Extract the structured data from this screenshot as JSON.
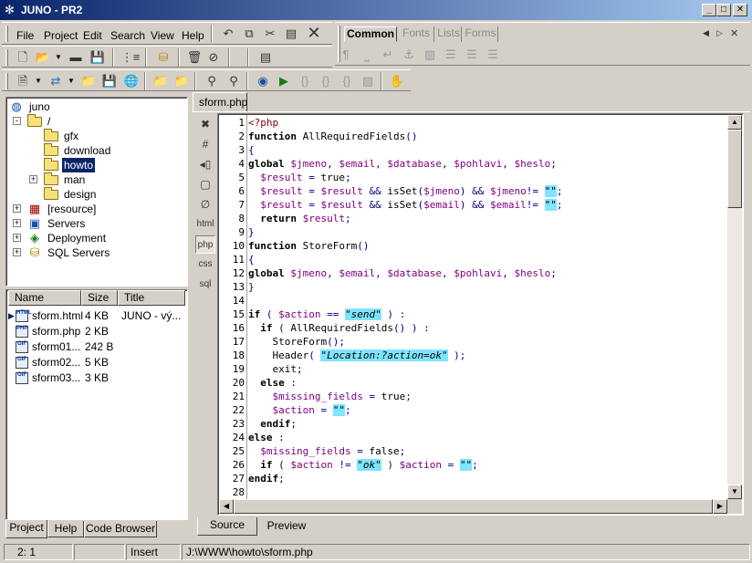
{
  "window": {
    "title": "JUNO - PR2",
    "minimize_label": "_",
    "maximize_label": "□",
    "close_label": "✕"
  },
  "menu": [
    "File",
    "Project",
    "Edit",
    "Search",
    "View",
    "Help"
  ],
  "formatting_tabs": [
    "Common",
    "Fonts",
    "Lists",
    "Forms"
  ],
  "icons": {
    "toolbar1": [
      "new-file-icon",
      "open-folder-icon",
      "save-icon",
      "save-all-icon",
      "tree-view-icon",
      "database-icon",
      "delete-icon",
      "block-icon",
      "undo-icon",
      "copy-icon",
      "cut-icon",
      "paste-icon",
      "close-icon",
      "list-icon"
    ],
    "format": [
      "paragraph-icon",
      "space-icon",
      "line-break-icon",
      "anchor-icon",
      "image-icon",
      "align-left-icon",
      "align-center-icon",
      "align-right-icon"
    ],
    "toolbar2": [
      "document-icon",
      "connect-icon",
      "folder-up-icon",
      "save-disk-icon",
      "globe-icon",
      "folder-stars-icon",
      "folder-go-icon",
      "tag-search-icon",
      "tag-icon",
      "browser-icon",
      "run-icon",
      "step-icon",
      "step-into-icon",
      "step-out-icon",
      "stop-icon",
      "hand-icon"
    ]
  },
  "tree": {
    "root": "juno",
    "items": [
      {
        "label": "/",
        "depth": 1,
        "expander": "-",
        "type": "folder"
      },
      {
        "label": "gfx",
        "depth": 2,
        "expander": "",
        "type": "folder"
      },
      {
        "label": "download",
        "depth": 2,
        "expander": "",
        "type": "folder"
      },
      {
        "label": "howto",
        "depth": 2,
        "expander": "",
        "type": "folder",
        "selected": true
      },
      {
        "label": "man",
        "depth": 2,
        "expander": "+",
        "type": "folder"
      },
      {
        "label": "design",
        "depth": 2,
        "expander": "",
        "type": "folder"
      },
      {
        "label": "[resource]",
        "depth": 1,
        "expander": "+",
        "type": "resource"
      },
      {
        "label": "Servers",
        "depth": 1,
        "expander": "+",
        "type": "servers"
      },
      {
        "label": "Deployment",
        "depth": 1,
        "expander": "+",
        "type": "deployment"
      },
      {
        "label": "SQL Servers",
        "depth": 1,
        "expander": "+",
        "type": "sql"
      }
    ]
  },
  "file_list": {
    "columns": [
      "Name",
      "Size",
      "Title"
    ],
    "rows": [
      {
        "name": "sform.html",
        "size": "4 KB",
        "title": "JUNO - vý...",
        "icon": "HTML",
        "current": true
      },
      {
        "name": "sform.php",
        "size": "2 KB",
        "title": "",
        "icon": "PHP"
      },
      {
        "name": "sform01...",
        "size": "242 B",
        "title": "",
        "icon": "GIF"
      },
      {
        "name": "sform02...",
        "size": "5 KB",
        "title": "",
        "icon": "GIF"
      },
      {
        "name": "sform03...",
        "size": "3 KB",
        "title": "",
        "icon": "GIF"
      }
    ]
  },
  "left_tabs": [
    "Project",
    "Help",
    "Code Browser"
  ],
  "editor": {
    "file_tab": "sform.php",
    "side_buttons": [
      "✖",
      "#",
      "◂▯",
      "▢",
      "∅",
      "html",
      "php",
      "css",
      "sql"
    ],
    "lines": [
      [
        [
          "php-tag",
          "<?php"
        ]
      ],
      [
        [
          "kw",
          "function"
        ],
        [
          "plain",
          " AllRequiredFields"
        ],
        [
          "op",
          "()"
        ]
      ],
      [
        [
          "op",
          "{"
        ]
      ],
      [
        [
          "kw",
          "global"
        ],
        [
          "plain",
          " "
        ],
        [
          "var",
          "$jmeno"
        ],
        [
          "op",
          ","
        ],
        [
          "plain",
          " "
        ],
        [
          "var",
          "$email"
        ],
        [
          "op",
          ","
        ],
        [
          "plain",
          " "
        ],
        [
          "var",
          "$database"
        ],
        [
          "op",
          ","
        ],
        [
          "plain",
          " "
        ],
        [
          "var",
          "$pohlavi"
        ],
        [
          "op",
          ","
        ],
        [
          "plain",
          " "
        ],
        [
          "var",
          "$heslo"
        ],
        [
          "op",
          ";"
        ]
      ],
      [
        [
          "plain",
          "  "
        ],
        [
          "var",
          "$result"
        ],
        [
          "op",
          " = "
        ],
        [
          "plain",
          "true"
        ],
        [
          "op",
          ";"
        ]
      ],
      [
        [
          "plain",
          "  "
        ],
        [
          "var",
          "$result"
        ],
        [
          "op",
          " = "
        ],
        [
          "var",
          "$result"
        ],
        [
          "op",
          " && "
        ],
        [
          "plain",
          "isSet"
        ],
        [
          "op",
          "("
        ],
        [
          "var",
          "$jmeno"
        ],
        [
          "op",
          ")"
        ],
        [
          "op",
          " && "
        ],
        [
          "var",
          "$jmeno"
        ],
        [
          "op",
          "!= "
        ],
        [
          "str",
          "\"\""
        ],
        [
          "op",
          ";"
        ]
      ],
      [
        [
          "plain",
          "  "
        ],
        [
          "var",
          "$result"
        ],
        [
          "op",
          " = "
        ],
        [
          "var",
          "$result"
        ],
        [
          "op",
          " && "
        ],
        [
          "plain",
          "isSet"
        ],
        [
          "op",
          "("
        ],
        [
          "var",
          "$email"
        ],
        [
          "op",
          ")"
        ],
        [
          "op",
          " && "
        ],
        [
          "var",
          "$email"
        ],
        [
          "op",
          "!= "
        ],
        [
          "str",
          "\"\""
        ],
        [
          "op",
          ";"
        ]
      ],
      [
        [
          "plain",
          "  "
        ],
        [
          "kw",
          "return"
        ],
        [
          "plain",
          " "
        ],
        [
          "var",
          "$result"
        ],
        [
          "op",
          ";"
        ]
      ],
      [
        [
          "op",
          "}"
        ]
      ],
      [
        [
          "kw",
          "function"
        ],
        [
          "plain",
          " StoreForm"
        ],
        [
          "op",
          "()"
        ]
      ],
      [
        [
          "op",
          "{"
        ]
      ],
      [
        [
          "kw",
          "global"
        ],
        [
          "plain",
          " "
        ],
        [
          "var",
          "$jmeno"
        ],
        [
          "op",
          ","
        ],
        [
          "plain",
          " "
        ],
        [
          "var",
          "$email"
        ],
        [
          "op",
          ","
        ],
        [
          "plain",
          " "
        ],
        [
          "var",
          "$database"
        ],
        [
          "op",
          ","
        ],
        [
          "plain",
          " "
        ],
        [
          "var",
          "$pohlavi"
        ],
        [
          "op",
          ","
        ],
        [
          "plain",
          " "
        ],
        [
          "var",
          "$heslo"
        ],
        [
          "op",
          ";"
        ]
      ],
      [
        [
          "op",
          "}"
        ]
      ],
      [],
      [
        [
          "kw",
          "if"
        ],
        [
          "op",
          " ( "
        ],
        [
          "var",
          "$action"
        ],
        [
          "op",
          " == "
        ],
        [
          "str",
          "\"send\""
        ],
        [
          "op",
          " ) :"
        ]
      ],
      [
        [
          "plain",
          "  "
        ],
        [
          "kw",
          "if"
        ],
        [
          "op",
          " ( "
        ],
        [
          "plain",
          "AllRequiredFields"
        ],
        [
          "op",
          "() ) :"
        ]
      ],
      [
        [
          "plain",
          "    StoreForm"
        ],
        [
          "op",
          "();"
        ]
      ],
      [
        [
          "plain",
          "    Header"
        ],
        [
          "op",
          "( "
        ],
        [
          "str",
          "\"Location:?action=ok\""
        ],
        [
          "op",
          " );"
        ]
      ],
      [
        [
          "plain",
          "    exit"
        ],
        [
          "op",
          ";"
        ]
      ],
      [
        [
          "plain",
          "  "
        ],
        [
          "kw",
          "else"
        ],
        [
          "op",
          " :"
        ]
      ],
      [
        [
          "plain",
          "    "
        ],
        [
          "var",
          "$missing_fields"
        ],
        [
          "op",
          " = "
        ],
        [
          "plain",
          "true"
        ],
        [
          "op",
          ";"
        ]
      ],
      [
        [
          "plain",
          "    "
        ],
        [
          "var",
          "$action"
        ],
        [
          "op",
          " = "
        ],
        [
          "str",
          "\"\""
        ],
        [
          "op",
          ";"
        ]
      ],
      [
        [
          "plain",
          "  "
        ],
        [
          "kw",
          "endif"
        ],
        [
          "op",
          ";"
        ]
      ],
      [
        [
          "kw",
          "else"
        ],
        [
          "op",
          " :"
        ]
      ],
      [
        [
          "plain",
          "  "
        ],
        [
          "var",
          "$missing_fields"
        ],
        [
          "op",
          " = "
        ],
        [
          "plain",
          "false"
        ],
        [
          "op",
          ";"
        ]
      ],
      [
        [
          "plain",
          "  "
        ],
        [
          "kw",
          "if"
        ],
        [
          "op",
          " ( "
        ],
        [
          "var",
          "$action"
        ],
        [
          "op",
          " != "
        ],
        [
          "str",
          "\"ok\""
        ],
        [
          "op",
          " ) "
        ],
        [
          "var",
          "$action"
        ],
        [
          "op",
          " = "
        ],
        [
          "str",
          "\"\""
        ],
        [
          "op",
          ";"
        ]
      ],
      [
        [
          "kw",
          "endif"
        ],
        [
          "op",
          ";"
        ]
      ],
      []
    ]
  },
  "bottom_tabs": [
    "Source",
    "Preview"
  ],
  "status": {
    "position": "2:  1",
    "mode": "Insert",
    "path": "J:\\WWW\\howto\\sform.php"
  },
  "colors": {
    "titlebar_start": "#0a246a",
    "titlebar_end": "#a6caf0",
    "selection": "#0a246a",
    "string_highlight": "#7fe4ff",
    "variable": "#800080"
  }
}
